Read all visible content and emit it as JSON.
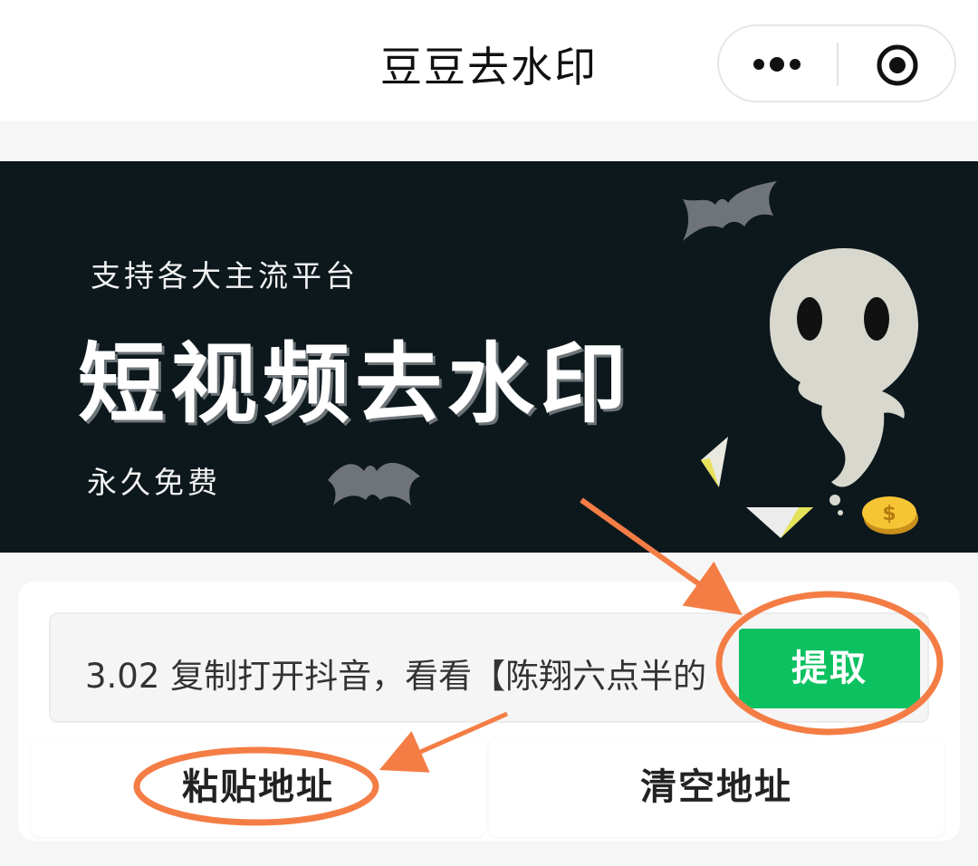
{
  "header": {
    "title": "豆豆去水印",
    "menu_icon": "more-dots-icon",
    "close_icon": "target-close-icon"
  },
  "banner": {
    "subtitle": "支持各大主流平台",
    "title": "短视频去水印",
    "tagline": "永久免费",
    "background": "#0d181d"
  },
  "form": {
    "url_value": "3.02 复制打开抖音，看看【陈翔六点半的",
    "extract_label": "提取",
    "paste_label": "粘贴地址",
    "clear_label": "清空地址"
  },
  "colors": {
    "accent": "#0cc160",
    "annotation": "#f47d45"
  }
}
